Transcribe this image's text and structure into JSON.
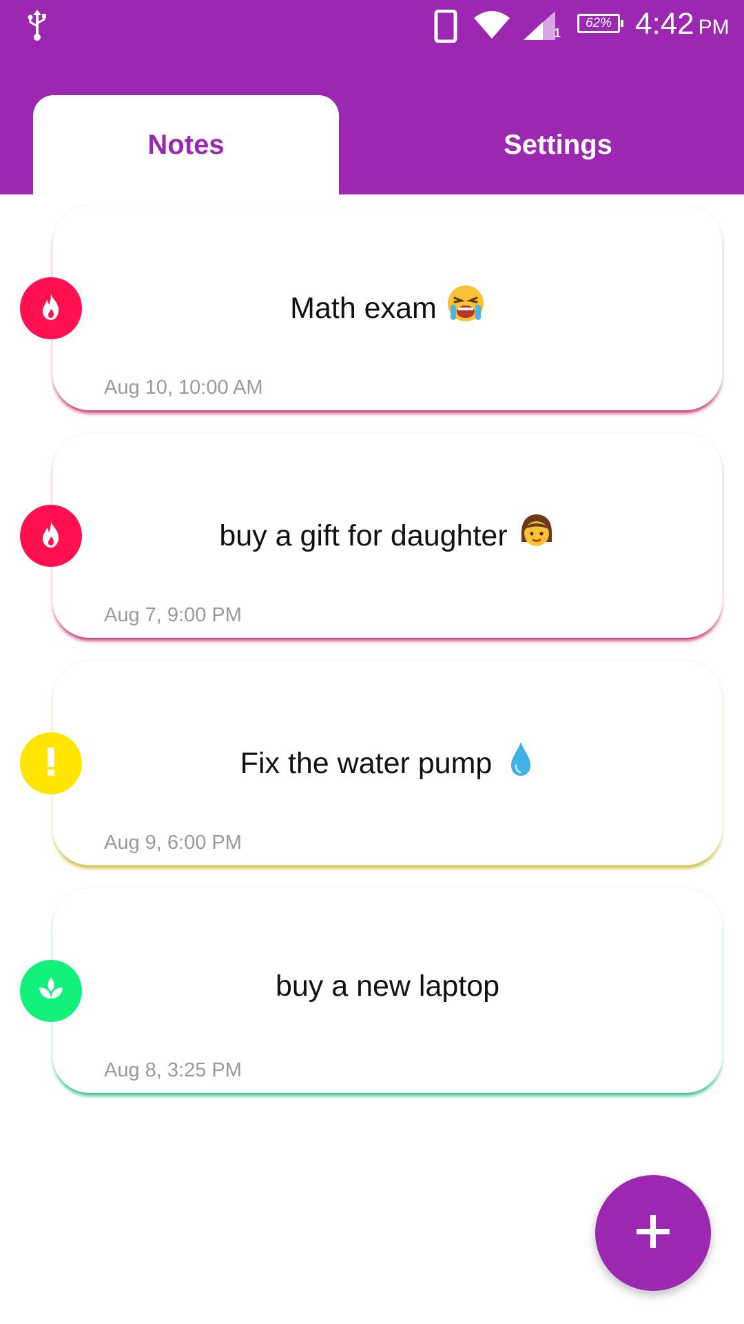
{
  "status_bar": {
    "battery_percent": "62%",
    "time": "4:42",
    "ampm": "PM",
    "signal_sub": "1",
    "icons": [
      "usb-icon",
      "phone-icon",
      "wifi-icon",
      "signal-icon",
      "battery-icon"
    ]
  },
  "tabs": [
    {
      "label": "Notes",
      "active": true
    },
    {
      "label": "Settings",
      "active": false
    }
  ],
  "notes": [
    {
      "title": "Math exam",
      "date": "Aug 10, 10:00 AM",
      "priority": "high",
      "priority_icon": "fire-icon",
      "priority_color": "#ff1150",
      "shadow_color": "#c8306a",
      "emoji": "crying-face-emoji"
    },
    {
      "title": "buy a gift for daughter",
      "date": "Aug 7, 9:00 PM",
      "priority": "high",
      "priority_icon": "fire-icon",
      "priority_color": "#ff1150",
      "shadow_color": "#c8306a",
      "emoji": "girl-emoji"
    },
    {
      "title": "Fix the water pump",
      "date": "Aug 9, 6:00 PM",
      "priority": "medium",
      "priority_icon": "exclamation-icon",
      "priority_color": "#ffe500",
      "shadow_color": "#c9b92c",
      "emoji": "droplet-emoji"
    },
    {
      "title": "buy a new laptop",
      "date": "Aug 8, 3:25 PM",
      "priority": "low",
      "priority_icon": "sprout-icon",
      "priority_color": "#12f07c",
      "shadow_color": "#2cc27a",
      "emoji": ""
    }
  ],
  "fab": {
    "icon": "plus-icon",
    "color": "#9c27b0"
  },
  "colors": {
    "primary": "#9c27b0",
    "background": "#ffffff"
  }
}
